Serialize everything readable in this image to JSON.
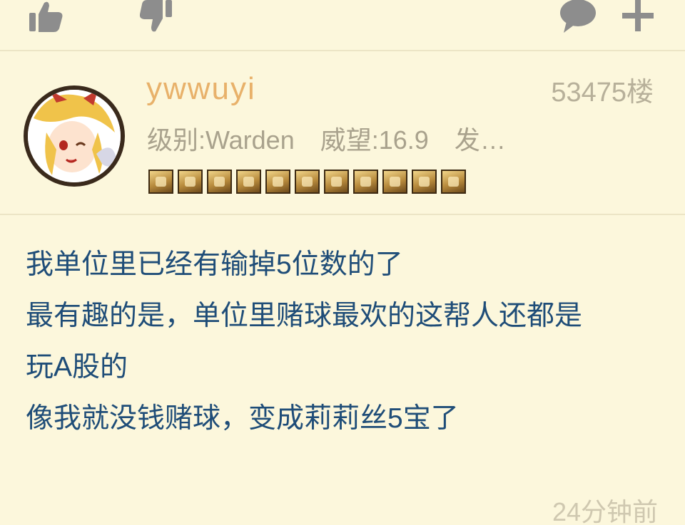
{
  "action_bar": {
    "icons": [
      "thumbs-up-icon",
      "thumbs-down-icon",
      "comment-icon",
      "plus-icon"
    ]
  },
  "post": {
    "username": "ywwuyi",
    "floor": "53475楼",
    "level": "级别:Warden",
    "reputation": "威望:16.9",
    "posts": "发…",
    "badge_count": 11,
    "body_lines": [
      "我单位里已经有输掉5位数的了",
      "最有趣的是，单位里赌球最欢的这帮人还都是",
      "玩A股的",
      "像我就没钱赌球，变成莉莉丝5宝了"
    ],
    "time": "24分钟前"
  },
  "colors": {
    "background": "#fcf7dc",
    "username": "#e8b16a",
    "body_text": "#1f4d78",
    "muted": "#a9a28d",
    "icon": "#8d8d8d"
  }
}
